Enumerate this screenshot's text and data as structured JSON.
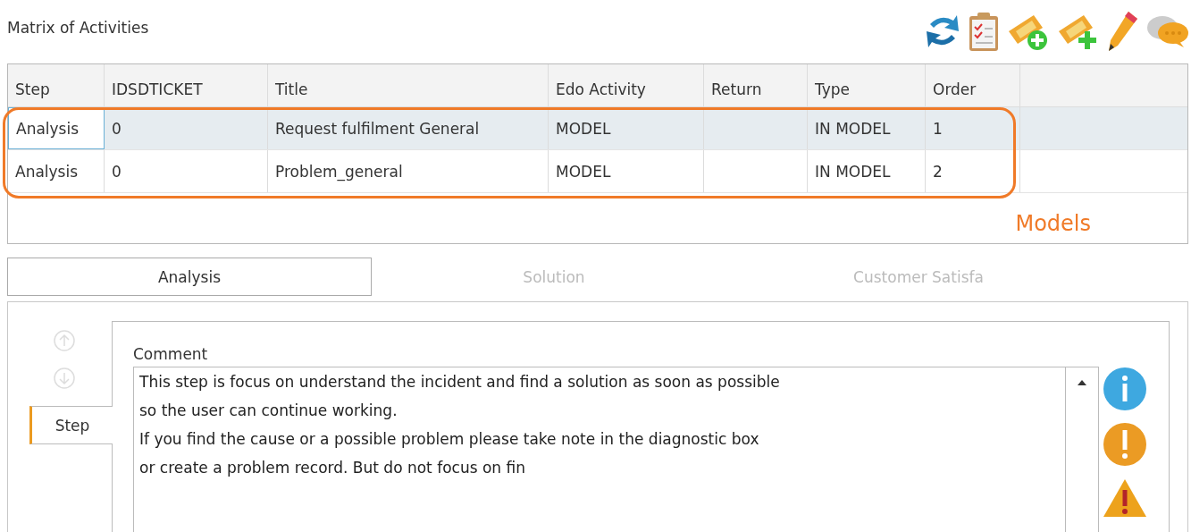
{
  "title": "Matrix of Activities",
  "toolbar": [
    {
      "kind": "refresh"
    },
    {
      "kind": "checklist"
    },
    {
      "kind": "ticket-add"
    },
    {
      "kind": "ticket-plus"
    },
    {
      "kind": "pencil"
    },
    {
      "kind": "chat"
    }
  ],
  "table": {
    "columns": [
      "Step",
      "IDSDTICKET",
      "Title",
      "Edo Activity",
      "Return",
      "Type",
      "Order"
    ],
    "rows": [
      {
        "selected": true,
        "cells": [
          "Analysis",
          "0",
          "Request fulfilment General",
          "MODEL",
          "",
          "IN MODEL",
          "1"
        ]
      },
      {
        "selected": false,
        "cells": [
          "Analysis",
          "0",
          "Problem_general",
          "MODEL",
          "",
          "IN MODEL",
          "2"
        ]
      }
    ],
    "annotation": "Models"
  },
  "tabs": [
    {
      "label": "Analysis",
      "selected": true
    },
    {
      "label": "Solution",
      "selected": false
    },
    {
      "label": "Customer Satisfa",
      "selected": false
    }
  ],
  "side_tabs": [
    {
      "label": "Step",
      "selected": true
    }
  ],
  "comment": {
    "label": "Comment",
    "value": "This step is focus on understand the incident and find a solution as soon as possible\nso the user can continue working.\nIf you find the cause or a possible problem please take note in the diagnostic box\nor create a problem record. But do not focus on fin"
  },
  "status_icons": [
    {
      "kind": "info"
    },
    {
      "kind": "notice"
    },
    {
      "kind": "warning"
    }
  ]
}
